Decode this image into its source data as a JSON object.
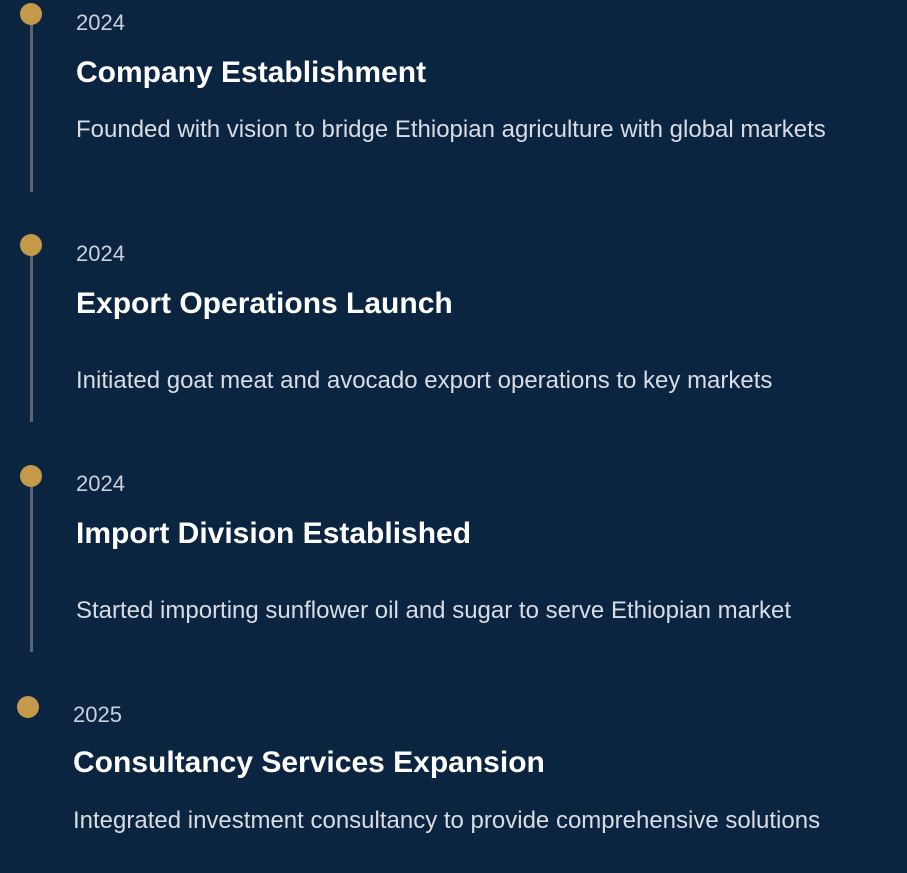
{
  "colors": {
    "background": "#0b2440",
    "accent_dot": "#c49a4a",
    "timeline_line": "#5b6470",
    "title_text": "#ffffff",
    "body_text": "#d7dde5",
    "year_text": "#c9d1dc"
  },
  "timeline": {
    "items": [
      {
        "year": "2024",
        "title": "Company Establishment",
        "description": "Founded with vision to bridge Ethiopian agriculture with global markets"
      },
      {
        "year": "2024",
        "title": "Export Operations Launch",
        "description": "Initiated goat meat and avocado export operations to key markets"
      },
      {
        "year": "2024",
        "title": "Import Division Established",
        "description": "Started importing sunflower oil and sugar to serve Ethiopian market"
      },
      {
        "year": "2025",
        "title": "Consultancy Services Expansion",
        "description": "Integrated investment consultancy to provide comprehensive solutions"
      }
    ]
  }
}
